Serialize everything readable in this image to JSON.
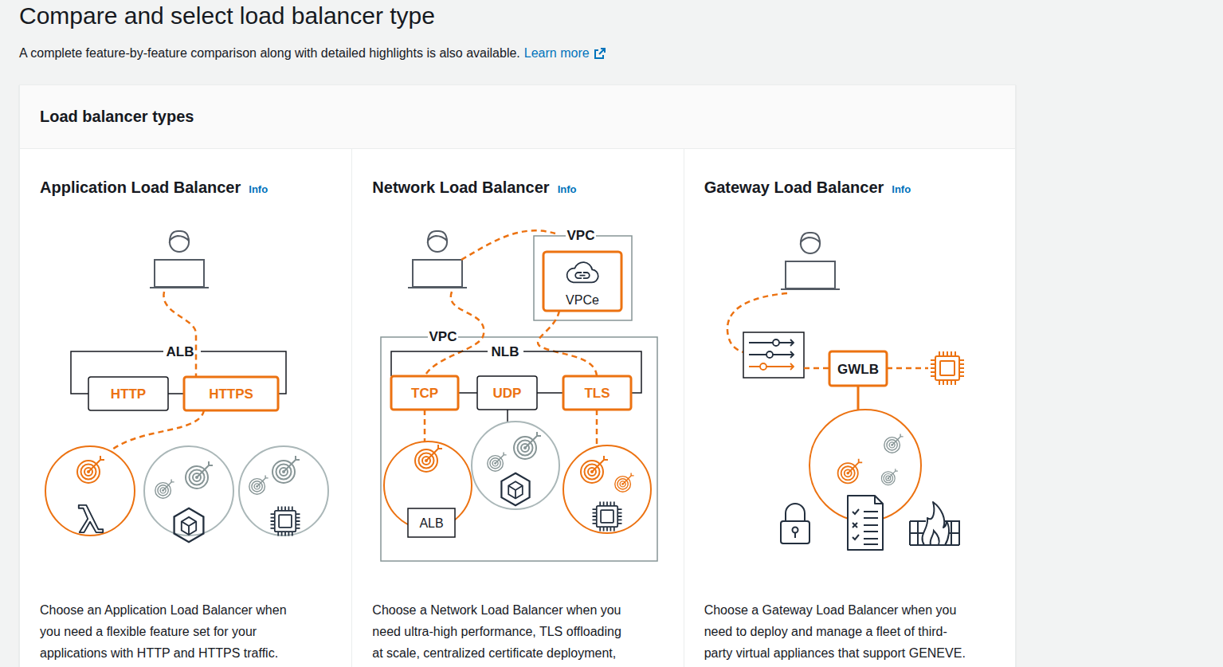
{
  "page": {
    "title": "Compare and select load balancer type",
    "subtitle": "A complete feature-by-feature comparison along with detailed highlights is also available.",
    "link": "Learn more"
  },
  "panel": {
    "title": "Load balancer types"
  },
  "types": [
    {
      "name": "Application Load Balancer",
      "info": "Info",
      "diagram": {
        "group": "ALB",
        "listeners": [
          {
            "label": "HTTP",
            "highlighted": false
          },
          {
            "label": "HTTPS",
            "highlighted": true
          }
        ],
        "targets": [
          {
            "highlighted": true
          },
          {
            "highlighted": false
          },
          {
            "highlighted": false
          }
        ]
      },
      "description_lines": [
        "Choose an Application Load Balancer when",
        "you need a flexible feature set for your",
        "applications with HTTP and HTTPS traffic."
      ]
    },
    {
      "name": "Network Load Balancer",
      "info": "Info",
      "diagram": {
        "vpc": "VPC",
        "endpoint_vpc": "VPC",
        "endpoint": "VPCe",
        "group": "NLB",
        "listeners": [
          {
            "label": "TCP",
            "highlighted": true
          },
          {
            "label": "UDP",
            "highlighted": false
          },
          {
            "label": "TLS",
            "highlighted": true
          }
        ],
        "targets": [
          {
            "label": "ALB",
            "highlighted": true
          },
          {
            "highlighted": false
          },
          {
            "highlighted": true
          }
        ]
      },
      "description_lines": [
        "Choose a Network Load Balancer when you",
        "need ultra-high performance, TLS offloading",
        "at scale, centralized certificate deployment,"
      ]
    },
    {
      "name": "Gateway Load Balancer",
      "info": "Info",
      "diagram": {
        "group": "GWLB"
      },
      "description_lines": [
        "Choose a Gateway Load Balancer when you",
        "need to deploy and manage a fleet of third-",
        "party virtual appliances that support GENEVE."
      ]
    }
  ]
}
